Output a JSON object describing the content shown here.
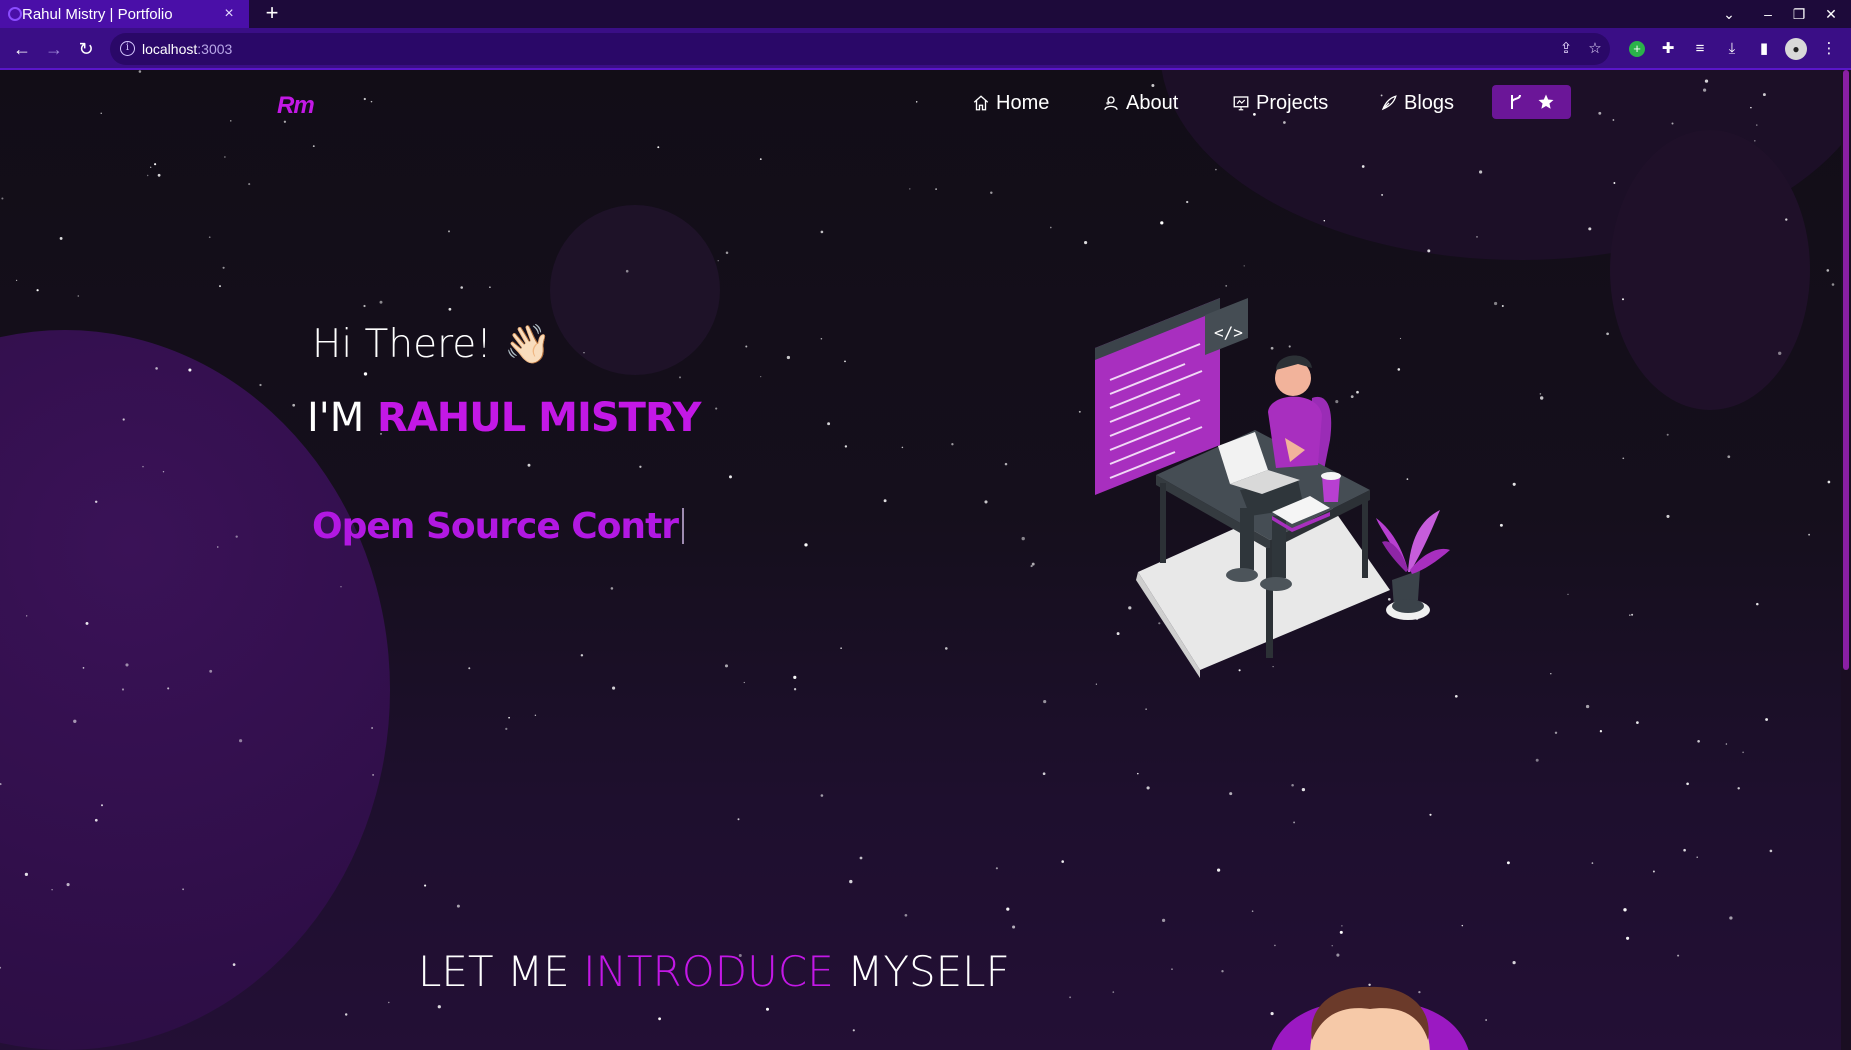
{
  "browser": {
    "tab_title": "Rahul Mistry | Portfolio",
    "tab_close": "×",
    "new_tab": "+",
    "url_host": "localhost",
    "url_port": ":3003"
  },
  "site": {
    "logo": "Rm",
    "nav": {
      "home": "Home",
      "about": "About",
      "projects": "Projects",
      "blogs": "Blogs"
    },
    "star_button": {
      "fork_icon": "fork-icon",
      "star_icon": "star-icon"
    }
  },
  "hero": {
    "greeting": "Hi There!",
    "wave_emoji": "👋🏻",
    "im_prefix": "I'M",
    "name": "RAHUL MISTRY",
    "typed_text": "Open Source Contr"
  },
  "intro": {
    "part1": "LET ME",
    "accent": "INTRODUCE",
    "part2": "MYSELF"
  },
  "colors": {
    "accent": "#c318e6",
    "background": "#150f1c",
    "tab_active": "#4a0fa8",
    "toolbar": "#3a0e86"
  }
}
